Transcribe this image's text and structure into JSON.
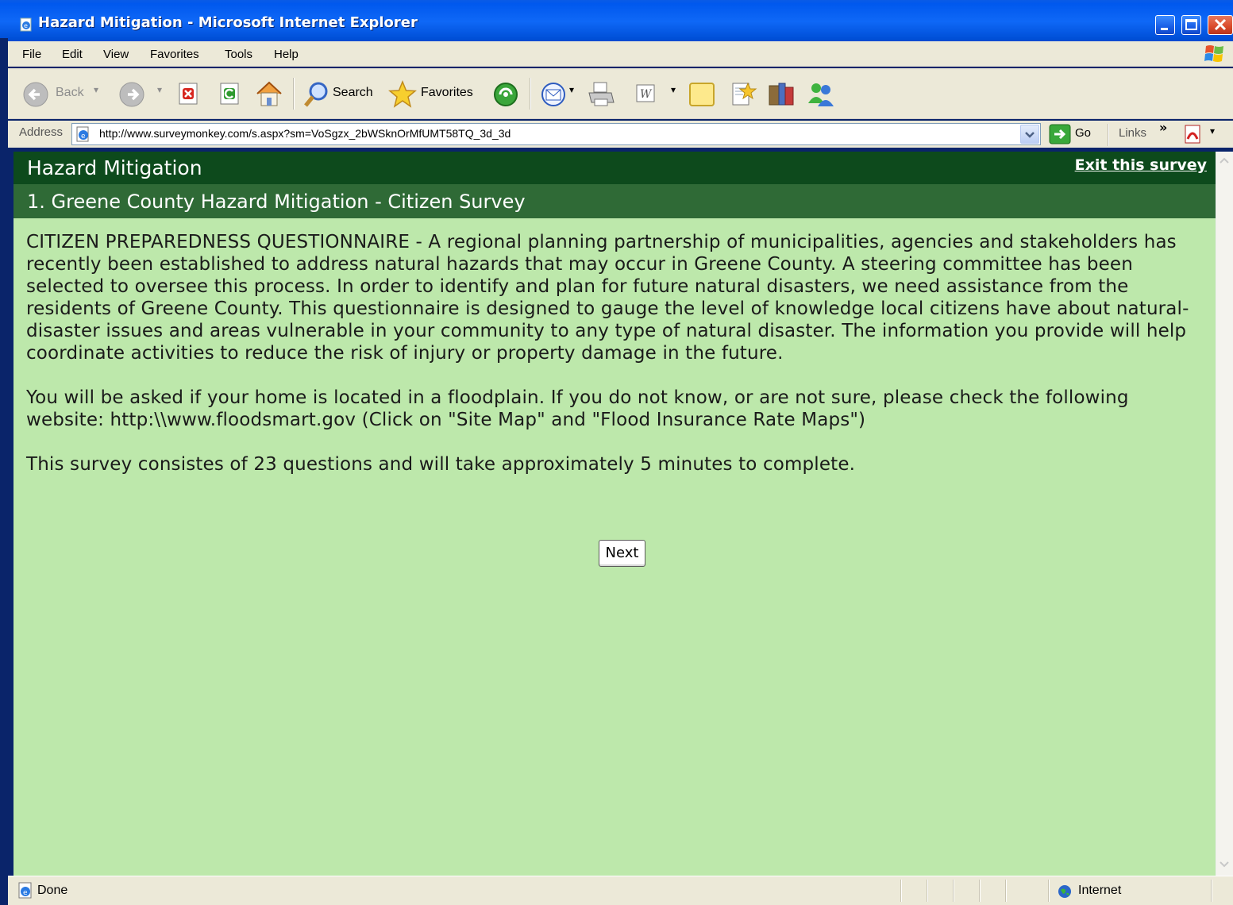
{
  "window": {
    "title": "Hazard Mitigation - Microsoft Internet Explorer"
  },
  "menu": {
    "items": [
      "File",
      "Edit",
      "View",
      "Favorites",
      "Tools",
      "Help"
    ]
  },
  "toolbar": {
    "back_label": "Back",
    "search_label": "Search",
    "favorites_label": "Favorites"
  },
  "address": {
    "label": "Address",
    "url": "http://www.surveymonkey.com/s.aspx?sm=VoSgzx_2bWSknOrMfUMT58TQ_3d_3d",
    "go_label": "Go",
    "links_label": "Links"
  },
  "survey": {
    "title": "Hazard Mitigation",
    "exit_label": "Exit this survey",
    "page_title": "1. Greene County Hazard Mitigation - Citizen Survey",
    "paragraphs": [
      "CITIZEN PREPAREDNESS QUESTIONNAIRE - A regional planning partnership of municipalities, agencies and stakeholders has recently been established to address natural hazards that may occur in Greene County. A steering committee has been selected to oversee this process. In order to identify and plan for future natural disasters, we need assistance from the residents of Greene County. This questionnaire is designed to gauge the level of knowledge local citizens have about natural-disaster issues and areas vulnerable in your community to any type of natural disaster. The information you provide will help coordinate activities to reduce the risk of injury or property damage in the future.",
      "You will be asked if your home is located in a floodplain. If you do not know, or are not sure, please check the following website: http:\\\\www.floodsmart.gov (Click on \"Site Map\" and \"Flood Insurance Rate Maps\")",
      "This survey consistes of 23 questions and will take approximately 5 minutes to complete."
    ],
    "next_label": "Next"
  },
  "status": {
    "text": "Done",
    "zone": "Internet"
  },
  "colors": {
    "content_bg": "#bde8ab",
    "survey_header_bg": "#0d4a1c",
    "page_header_bg": "#2f6a36",
    "titlebar_blue": "#0058ee"
  }
}
